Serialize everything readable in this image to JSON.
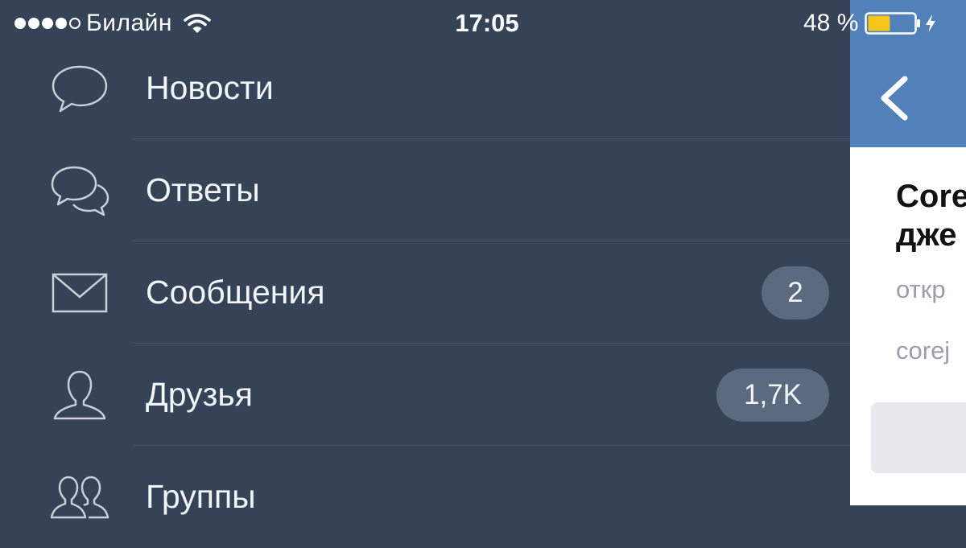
{
  "status_bar": {
    "carrier": "Билайн",
    "time": "17:05",
    "battery": "48 %",
    "battery_level": 0.48
  },
  "menu": [
    {
      "id": "news",
      "label": "Новости",
      "icon": "speech-bubble-icon",
      "badge": null
    },
    {
      "id": "answers",
      "label": "Ответы",
      "icon": "two-speech-bubbles-icon",
      "badge": null
    },
    {
      "id": "messages",
      "label": "Сообщения",
      "icon": "envelope-icon",
      "badge": "2"
    },
    {
      "id": "friends",
      "label": "Друзья",
      "icon": "person-icon",
      "badge": "1,7K"
    },
    {
      "id": "groups",
      "label": "Группы",
      "icon": "group-icon",
      "badge": null
    }
  ],
  "panel": {
    "title_line1": "Core",
    "title_line2": "дже",
    "subtitle1": "откр",
    "subtitle2": "corej"
  },
  "colors": {
    "menu_bg": "#364356",
    "badge_bg": "#5c6a7f",
    "header_blue": "#5281b9",
    "battery_fill": "#f5c518"
  }
}
